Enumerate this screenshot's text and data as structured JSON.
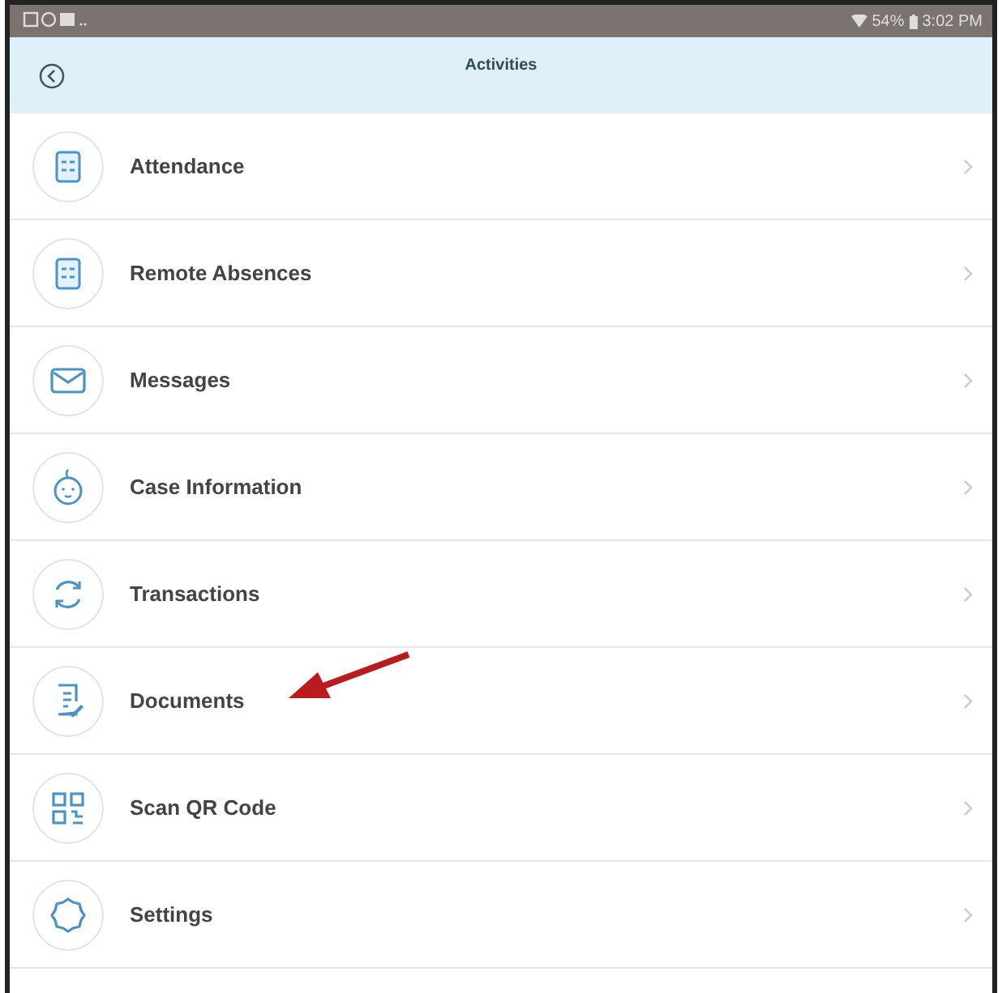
{
  "status_bar": {
    "battery": "54%",
    "time": "3:02 PM"
  },
  "header": {
    "title": "Activities"
  },
  "items": [
    {
      "label": "Attendance"
    },
    {
      "label": "Remote Absences"
    },
    {
      "label": "Messages"
    },
    {
      "label": "Case Information"
    },
    {
      "label": "Transactions"
    },
    {
      "label": "Documents"
    },
    {
      "label": "Scan QR Code"
    },
    {
      "label": "Settings"
    }
  ]
}
